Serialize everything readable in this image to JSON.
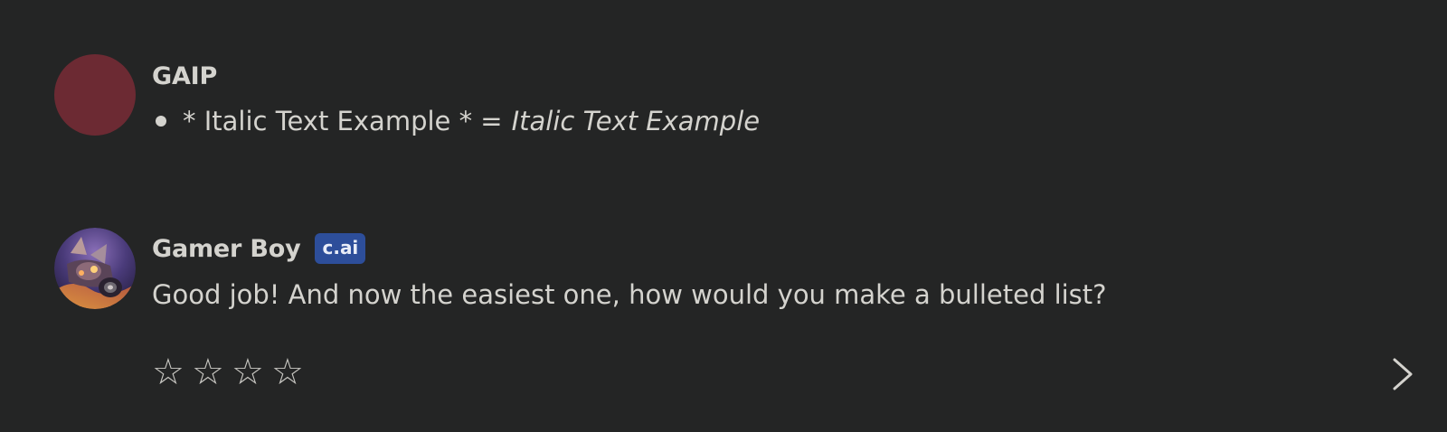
{
  "messages": {
    "user": {
      "name": "GAIP",
      "avatar_color": "#6c2a33",
      "bullet_plain": "* Italic Text Example * =",
      "bullet_italic": "Italic Text Example"
    },
    "bot": {
      "name": "Gamer Boy",
      "badge": "c.ai",
      "badge_color": "#2d4e9a",
      "text": "Good job! And now the easiest one, how would you make a bulleted list?"
    }
  },
  "rating": {
    "stars": [
      "☆",
      "☆",
      "☆",
      "☆"
    ]
  },
  "icons": {
    "next": "chevron-right-icon"
  },
  "colors": {
    "background": "#242525",
    "text": "#d4d3ce"
  }
}
